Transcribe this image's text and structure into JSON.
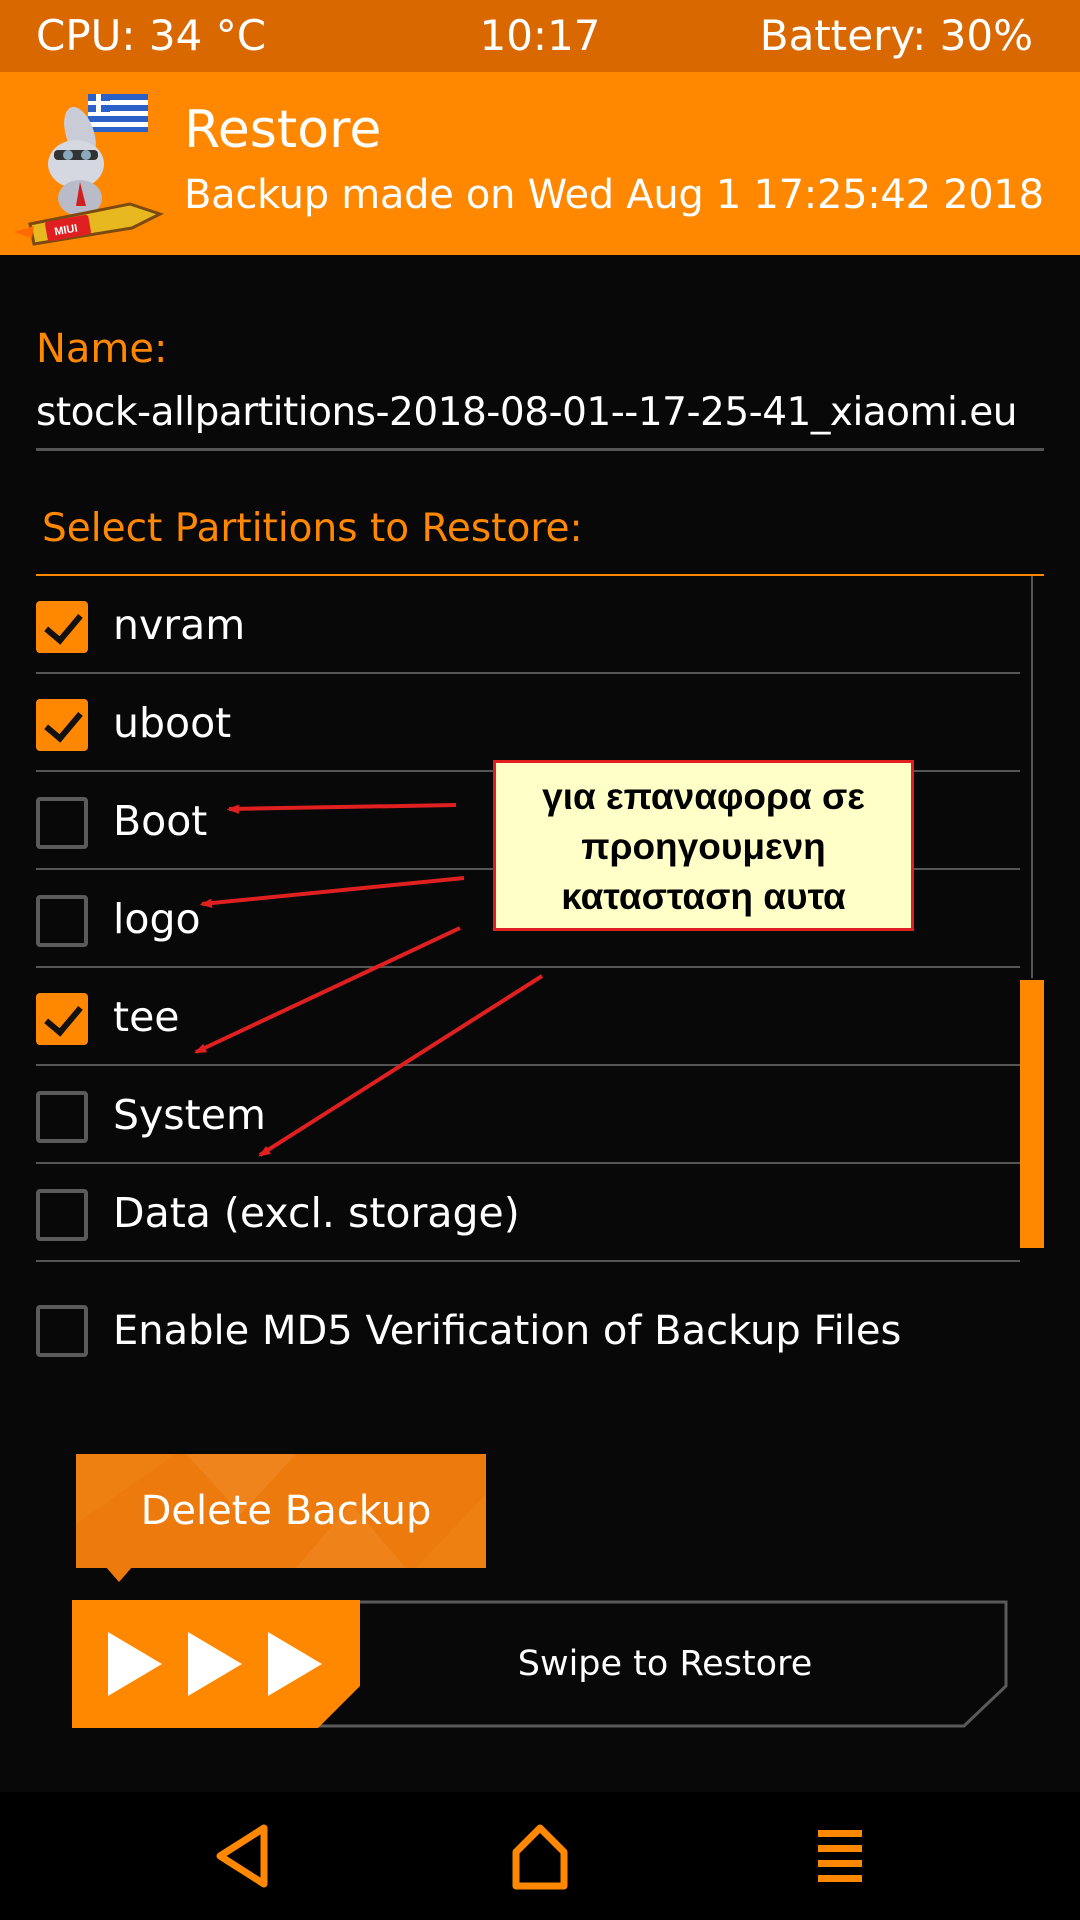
{
  "status_bar": {
    "cpu": "CPU: 34 °C",
    "time": "10:17",
    "battery": "Battery: 30%"
  },
  "header": {
    "title": "Restore",
    "subtitle": "Backup made on Wed Aug  1 17:25:42 2018",
    "logo_icon": "miui-hellas-rabbit-logo",
    "logo_text": "MIUI HELLAS"
  },
  "name": {
    "label": "Name:",
    "value": "stock-allpartitions-2018-08-01--17-25-41_xiaomi.eu"
  },
  "partitions": {
    "label": "Select Partitions to Restore:",
    "items": [
      {
        "label": "nvram",
        "checked": true
      },
      {
        "label": "uboot",
        "checked": true
      },
      {
        "label": "Boot",
        "checked": false
      },
      {
        "label": "logo",
        "checked": false
      },
      {
        "label": "tee",
        "checked": true
      },
      {
        "label": "System",
        "checked": false
      },
      {
        "label": "Data (excl. storage)",
        "checked": false
      }
    ]
  },
  "md5": {
    "label": "Enable MD5 Verification of Backup Files",
    "checked": false
  },
  "delete_button": {
    "label": "Delete Backup"
  },
  "swipe": {
    "label": "Swipe to Restore",
    "icon": "triple-play-arrows-icon"
  },
  "annotation": {
    "text": "για επαναφορα σε προηγουμενη κατασταση αυτα"
  },
  "nav": {
    "back_icon": "back-triangle-icon",
    "home_icon": "home-icon",
    "menu_icon": "menu-icon"
  },
  "colors": {
    "accent": "#ff8800",
    "status_bar": "#d96800",
    "background": "#080808",
    "note_bg": "#ffffc8",
    "arrow": "#e02020"
  }
}
